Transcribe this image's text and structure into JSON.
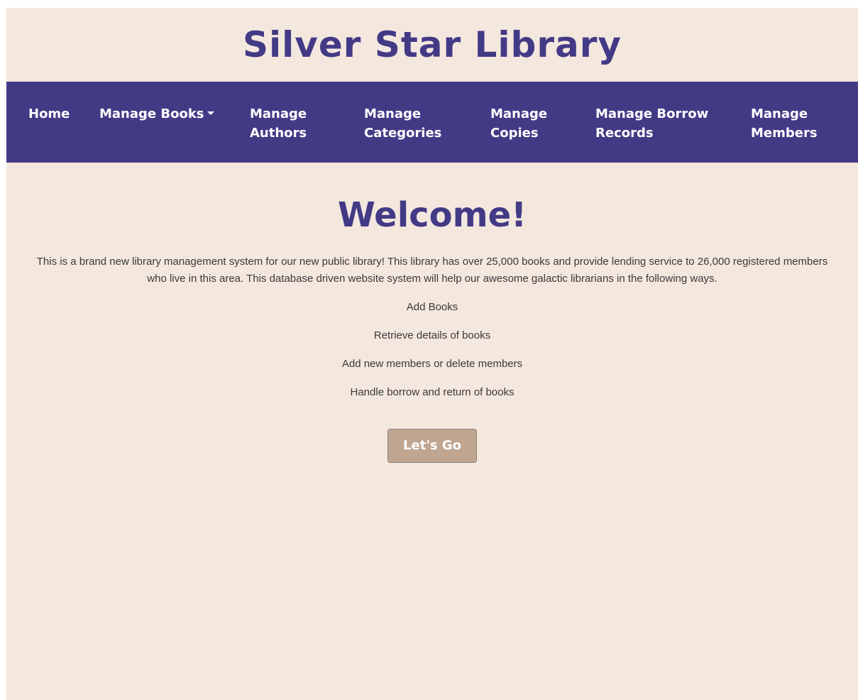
{
  "header": {
    "title": "Silver Star Library"
  },
  "nav": {
    "home": "Home",
    "manage_books": "Manage Books",
    "manage_authors_line1": "Manage",
    "manage_authors_line2": "Authors",
    "manage_categories_line1": "Manage",
    "manage_categories_line2": "Categories",
    "manage_copies_line1": "Manage",
    "manage_copies_line2": "Copies",
    "manage_borrow_line1": "Manage Borrow",
    "manage_borrow_line2": "Records",
    "manage_members_line1": "Manage",
    "manage_members_line2": "Members"
  },
  "main": {
    "heading": "Welcome!",
    "intro": "This is a brand new library management system for our new public library! This library has over 25,000 books and provide lending service to 26,000 registered members who live in this area. This database driven website system will help our awesome galactic librarians in the following ways.",
    "features": [
      "Add Books",
      "Retrieve details of books",
      "Add new members or delete members",
      "Handle borrow and return of books"
    ],
    "cta_label": "Let's Go"
  },
  "colors": {
    "page_background": "#f4e7de",
    "brand_purple": "#433a86",
    "button_tan": "#c0a590"
  },
  "icons": {
    "dropdown": "caret-down-icon"
  }
}
